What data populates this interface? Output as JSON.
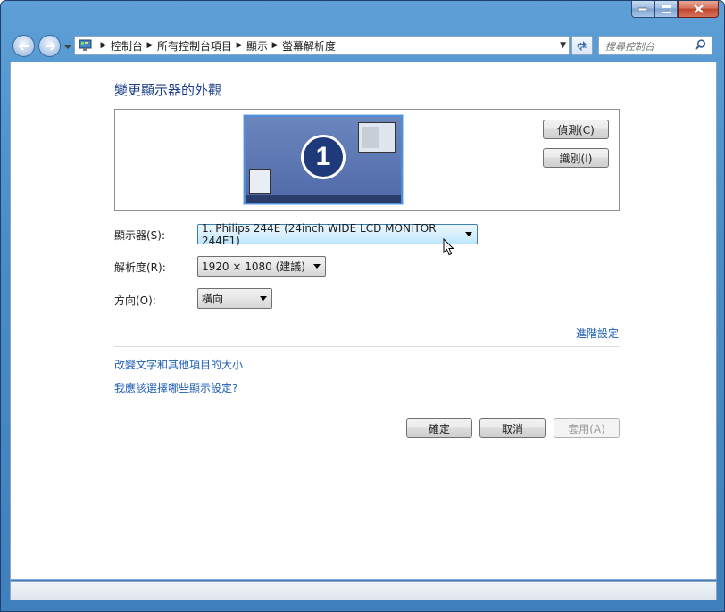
{
  "window": {
    "caption": {
      "minimize_icon": "minimize-icon",
      "maximize_icon": "maximize-icon",
      "close_icon": "close-icon"
    }
  },
  "nav": {
    "breadcrumbs": [
      "控制台",
      "所有控制台項目",
      "顯示",
      "螢幕解析度"
    ],
    "search_placeholder": "搜尋控制台"
  },
  "main": {
    "heading": "變更顯示器的外觀",
    "monitor_number": "1",
    "detect_label": "偵測(C)",
    "identify_label": "識別(I)",
    "display_label": "顯示器(S):",
    "display_value": "1. Philips 244E (24inch WIDE LCD MONITOR 244E1)",
    "resolution_label": "解析度(R):",
    "resolution_value": "1920 × 1080 (建議)",
    "orientation_label": "方向(O):",
    "orientation_value": "橫向",
    "advanced_link": "進階設定",
    "text_size_link": "改變文字和其他項目的大小",
    "which_settings_link": "我應該選擇哪些顯示設定?"
  },
  "footer": {
    "ok_label": "確定",
    "cancel_label": "取消",
    "apply_label": "套用(A)"
  }
}
